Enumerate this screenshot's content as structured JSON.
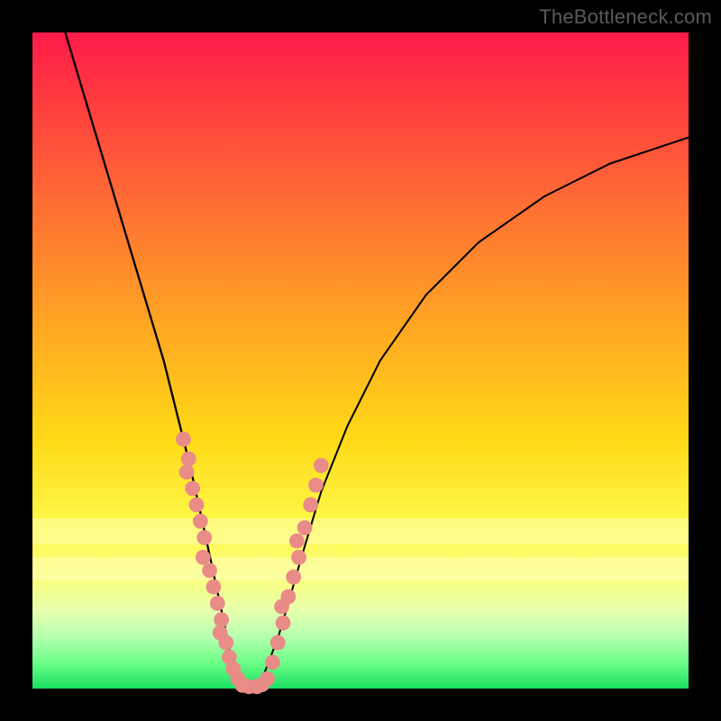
{
  "watermark": "TheBottleneck.com",
  "chart_data": {
    "type": "line",
    "title": "",
    "xlabel": "",
    "ylabel": "",
    "xlim": [
      0,
      100
    ],
    "ylim": [
      0,
      100
    ],
    "grid": false,
    "series": [
      {
        "name": "left-branch",
        "x": [
          5,
          8,
          11,
          14,
          17,
          20,
          22,
          24,
          26,
          27.5,
          29,
          30,
          30.8,
          31.5,
          32
        ],
        "y": [
          100,
          90,
          80,
          70,
          60,
          50,
          42,
          34,
          25,
          18,
          11,
          6,
          3,
          1,
          0
        ]
      },
      {
        "name": "right-branch",
        "x": [
          34,
          35,
          36,
          37.5,
          39,
          41,
          44,
          48,
          53,
          60,
          68,
          78,
          88,
          100
        ],
        "y": [
          0,
          1.5,
          4,
          8,
          13,
          20,
          30,
          40,
          50,
          60,
          68,
          75,
          80,
          84
        ]
      }
    ],
    "markers": [
      {
        "name": "left-cluster",
        "color": "#e98b87",
        "points": [
          [
            23.0,
            38.0
          ],
          [
            23.8,
            35.0
          ],
          [
            23.5,
            33.0
          ],
          [
            24.4,
            30.5
          ],
          [
            25.0,
            28.0
          ],
          [
            25.6,
            25.5
          ],
          [
            26.2,
            23.0
          ],
          [
            26.0,
            20.0
          ],
          [
            27.0,
            18.0
          ],
          [
            27.6,
            15.5
          ],
          [
            28.2,
            13.0
          ],
          [
            28.8,
            10.5
          ],
          [
            28.6,
            8.5
          ],
          [
            29.5,
            7.0
          ],
          [
            30.0,
            4.8
          ],
          [
            30.6,
            3.0
          ],
          [
            31.3,
            1.5
          ],
          [
            32.0,
            0.5
          ],
          [
            33.0,
            0.3
          ],
          [
            34.2,
            0.3
          ],
          [
            35.0,
            0.6
          ],
          [
            35.8,
            1.5
          ]
        ]
      },
      {
        "name": "right-cluster",
        "color": "#e98b87",
        "points": [
          [
            36.6,
            4.0
          ],
          [
            37.4,
            7.0
          ],
          [
            38.2,
            10.0
          ],
          [
            38.0,
            12.5
          ],
          [
            39.0,
            14.0
          ],
          [
            39.8,
            17.0
          ],
          [
            40.6,
            20.0
          ],
          [
            40.3,
            22.5
          ],
          [
            41.5,
            24.5
          ],
          [
            42.4,
            28.0
          ],
          [
            43.2,
            31.0
          ],
          [
            44.0,
            34.0
          ]
        ]
      }
    ],
    "background_gradient": {
      "top": "#ff1a4a",
      "mid1": "#ffa722",
      "mid2": "#fff94a",
      "bottom": "#18e060"
    }
  }
}
